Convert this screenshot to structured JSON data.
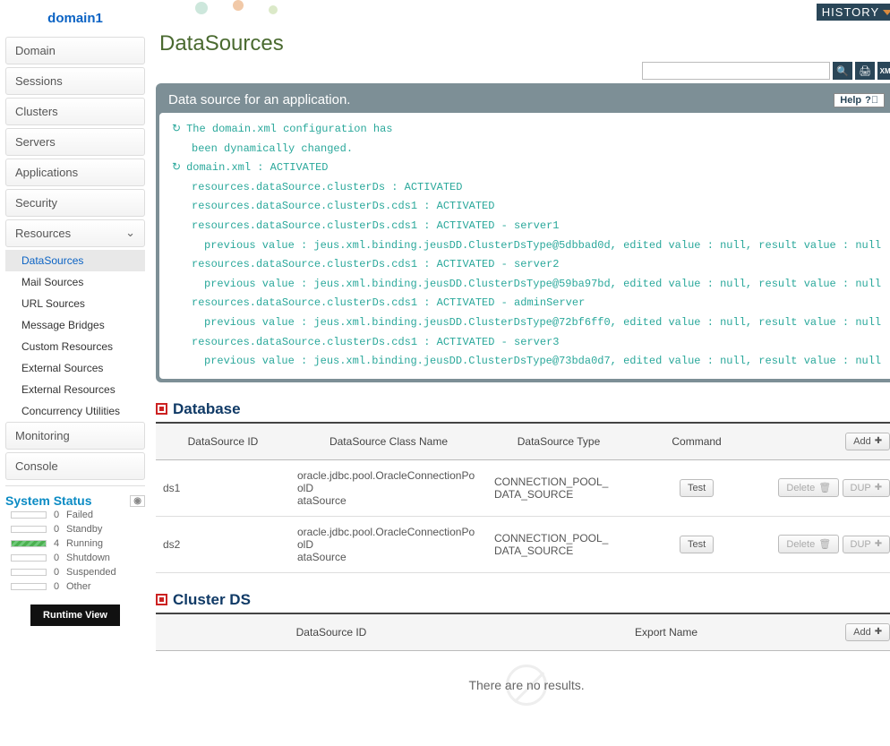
{
  "sidebar": {
    "domain": "domain1",
    "items": [
      {
        "label": "Domain"
      },
      {
        "label": "Sessions"
      },
      {
        "label": "Clusters"
      },
      {
        "label": "Servers"
      },
      {
        "label": "Applications"
      },
      {
        "label": "Security"
      },
      {
        "label": "Resources",
        "expanded": true,
        "children": [
          {
            "label": "DataSources",
            "active": true
          },
          {
            "label": "Mail Sources"
          },
          {
            "label": "URL Sources"
          },
          {
            "label": "Message Bridges"
          },
          {
            "label": "Custom Resources"
          },
          {
            "label": "External Sources"
          },
          {
            "label": "External Resources"
          },
          {
            "label": "Concurrency Utilities"
          }
        ]
      },
      {
        "label": "Monitoring"
      },
      {
        "label": "Console"
      }
    ],
    "status_title": "System Status",
    "status": [
      {
        "count": "0",
        "label": "Failed"
      },
      {
        "count": "0",
        "label": "Standby"
      },
      {
        "count": "4",
        "label": "Running",
        "running": true
      },
      {
        "count": "0",
        "label": "Shutdown"
      },
      {
        "count": "0",
        "label": "Suspended"
      },
      {
        "count": "0",
        "label": "Other"
      }
    ],
    "runtime_btn": "Runtime View"
  },
  "header": {
    "title": "DataSources",
    "history": "HISTORY",
    "search_icon": "search-icon",
    "print_icon": "print-icon",
    "xml_icon": "xml-icon"
  },
  "panel": {
    "title": "Data source for an application.",
    "help": "Help",
    "log": [
      {
        "icon": true,
        "indent": 0,
        "text": "The domain.xml configuration has"
      },
      {
        "icon": false,
        "indent": 1,
        "text": "been dynamically changed."
      },
      {
        "icon": true,
        "indent": 0,
        "text": "domain.xml : ACTIVATED"
      },
      {
        "icon": false,
        "indent": 1,
        "text": "resources.dataSource.clusterDs : ACTIVATED"
      },
      {
        "icon": false,
        "indent": 1,
        "text": "resources.dataSource.clusterDs.cds1 : ACTIVATED"
      },
      {
        "icon": false,
        "indent": 1,
        "text": "resources.dataSource.clusterDs.cds1 : ACTIVATED - server1"
      },
      {
        "icon": false,
        "indent": 2,
        "text": "previous value : jeus.xml.binding.jeusDD.ClusterDsType@5dbbad0d, edited value : null, result value : null"
      },
      {
        "icon": false,
        "indent": 1,
        "text": "resources.dataSource.clusterDs.cds1 : ACTIVATED - server2"
      },
      {
        "icon": false,
        "indent": 2,
        "text": "previous value : jeus.xml.binding.jeusDD.ClusterDsType@59ba97bd, edited value : null, result value : null"
      },
      {
        "icon": false,
        "indent": 1,
        "text": "resources.dataSource.clusterDs.cds1 : ACTIVATED - adminServer"
      },
      {
        "icon": false,
        "indent": 2,
        "text": "previous value : jeus.xml.binding.jeusDD.ClusterDsType@72bf6ff0, edited value : null, result value : null"
      },
      {
        "icon": false,
        "indent": 1,
        "text": "resources.dataSource.clusterDs.cds1 : ACTIVATED - server3"
      },
      {
        "icon": false,
        "indent": 2,
        "text": "previous value : jeus.xml.binding.jeusDD.ClusterDsType@73bda0d7, edited value : null, result value : null"
      }
    ]
  },
  "database": {
    "title": "Database",
    "columns": [
      "DataSource ID",
      "DataSource Class Name",
      "DataSource Type",
      "Command"
    ],
    "add": "Add",
    "rows": [
      {
        "id": "ds1",
        "cls": "oracle.jdbc.pool.OracleConnectionPoolDataSource",
        "type": "CONNECTION_POOL_DATA_SOURCE",
        "cmd": "Test",
        "del": "Delete",
        "dup": "DUP"
      },
      {
        "id": "ds2",
        "cls": "oracle.jdbc.pool.OracleConnectionPoolDataSource",
        "type": "CONNECTION_POOL_DATA_SOURCE",
        "cmd": "Test",
        "del": "Delete",
        "dup": "DUP"
      }
    ]
  },
  "cluster": {
    "title": "Cluster DS",
    "columns": [
      "DataSource ID",
      "Export Name"
    ],
    "add": "Add",
    "empty": "There are no results."
  }
}
